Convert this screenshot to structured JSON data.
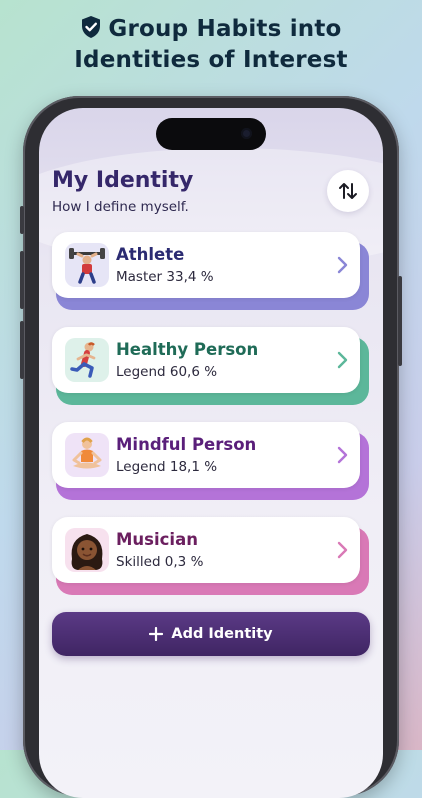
{
  "promo": {
    "line1": "Group Habits into",
    "line2": "Identities of Interest",
    "icon": "shield-check-icon"
  },
  "header": {
    "title": "My Identity",
    "subtitle": "How I define myself.",
    "sort_icon": "sort-arrows-icon"
  },
  "identities": [
    {
      "name": "Athlete",
      "level": "Master 33,4 %",
      "avatar": "weightlifter-icon",
      "color": "#2b2b72",
      "accent": "#8a86d6"
    },
    {
      "name": "Healthy Person",
      "level": "Legend 60,6 %",
      "avatar": "runner-icon",
      "color": "#1f6b57",
      "accent": "#5cb79a"
    },
    {
      "name": "Mindful Person",
      "level": "Legend 18,1 %",
      "avatar": "meditation-icon",
      "color": "#5a1f7a",
      "accent": "#b473d8"
    },
    {
      "name": "Musician",
      "level": "Skilled 0,3 %",
      "avatar": "person-avatar-icon",
      "color": "#6b1f5f",
      "accent": "#d979b6"
    }
  ],
  "add_button": {
    "label": "Add Identity",
    "icon": "plus-icon"
  }
}
